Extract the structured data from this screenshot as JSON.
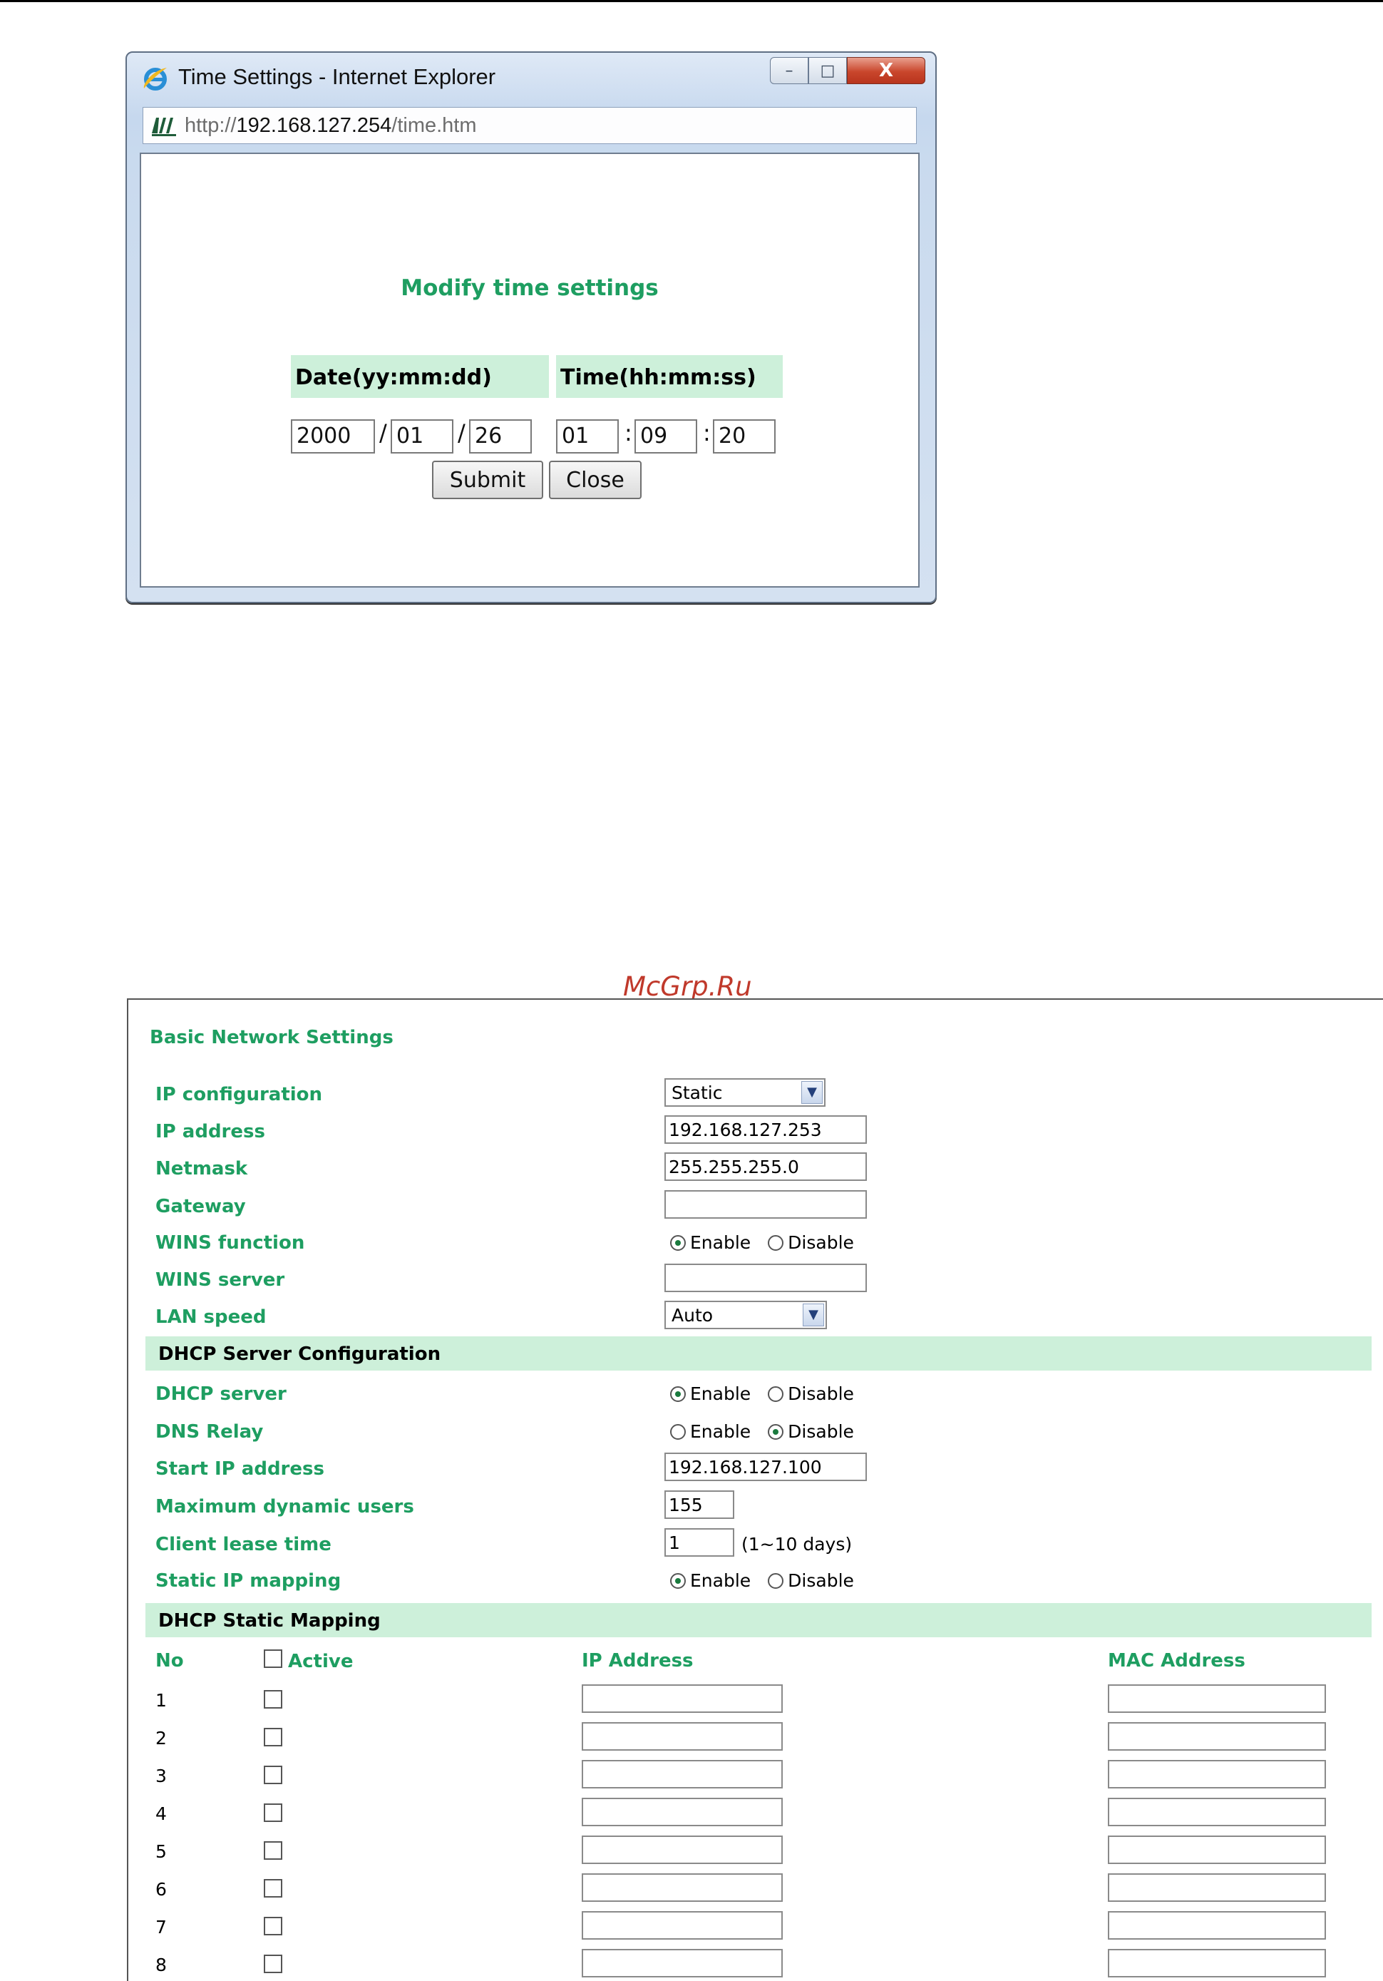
{
  "ie_window": {
    "title": "Time Settings - Internet Explorer",
    "url_prefix": "http://",
    "url_host": "192.168.127.254",
    "url_path": "/time.htm",
    "minimize": "–",
    "maximize": "□",
    "close": "X"
  },
  "time_form": {
    "heading": "Modify time settings",
    "date_header": "Date(yy:mm:dd)",
    "time_header": "Time(hh:mm:ss)",
    "year": "2000",
    "month": "01",
    "day": "26",
    "hour": "01",
    "minute": "09",
    "second": "20",
    "date_sep": "/",
    "time_sep": ":",
    "submit_label": "Submit",
    "close_label": "Close"
  },
  "watermark": "McGrp.Ru",
  "network": {
    "title": "Basic Network Settings",
    "ip_configuration_label": "IP configuration",
    "ip_configuration_value": "Static",
    "ip_address_label": "IP address",
    "ip_address_value": "192.168.127.253",
    "netmask_label": "Netmask",
    "netmask_value": "255.255.255.0",
    "gateway_label": "Gateway",
    "gateway_value": "",
    "wins_function_label": "WINS function",
    "wins_server_label": "WINS server",
    "wins_server_value": "",
    "lan_speed_label": "LAN speed",
    "lan_speed_value": "Auto",
    "enable": "Enable",
    "disable": "Disable",
    "wins_function_selected": "Enable"
  },
  "dhcp": {
    "section_title": "DHCP Server Configuration",
    "server_label": "DHCP server",
    "server_selected": "Enable",
    "dns_relay_label": "DNS Relay",
    "dns_relay_selected": "Disable",
    "start_ip_label": "Start IP address",
    "start_ip_value": "192.168.127.100",
    "max_users_label": "Maximum dynamic users",
    "max_users_value": "155",
    "lease_time_label": "Client lease time",
    "lease_time_value": "1",
    "lease_time_hint": "(1~10 days)",
    "static_ip_mapping_label": "Static IP mapping",
    "static_ip_mapping_selected": "Enable"
  },
  "static_mapping": {
    "section_title": "DHCP Static Mapping",
    "col_no": "No",
    "col_active": "Active",
    "col_ip": "IP Address",
    "col_mac": "MAC Address",
    "rows": [
      "1",
      "2",
      "3",
      "4",
      "5",
      "6",
      "7",
      "8"
    ]
  }
}
